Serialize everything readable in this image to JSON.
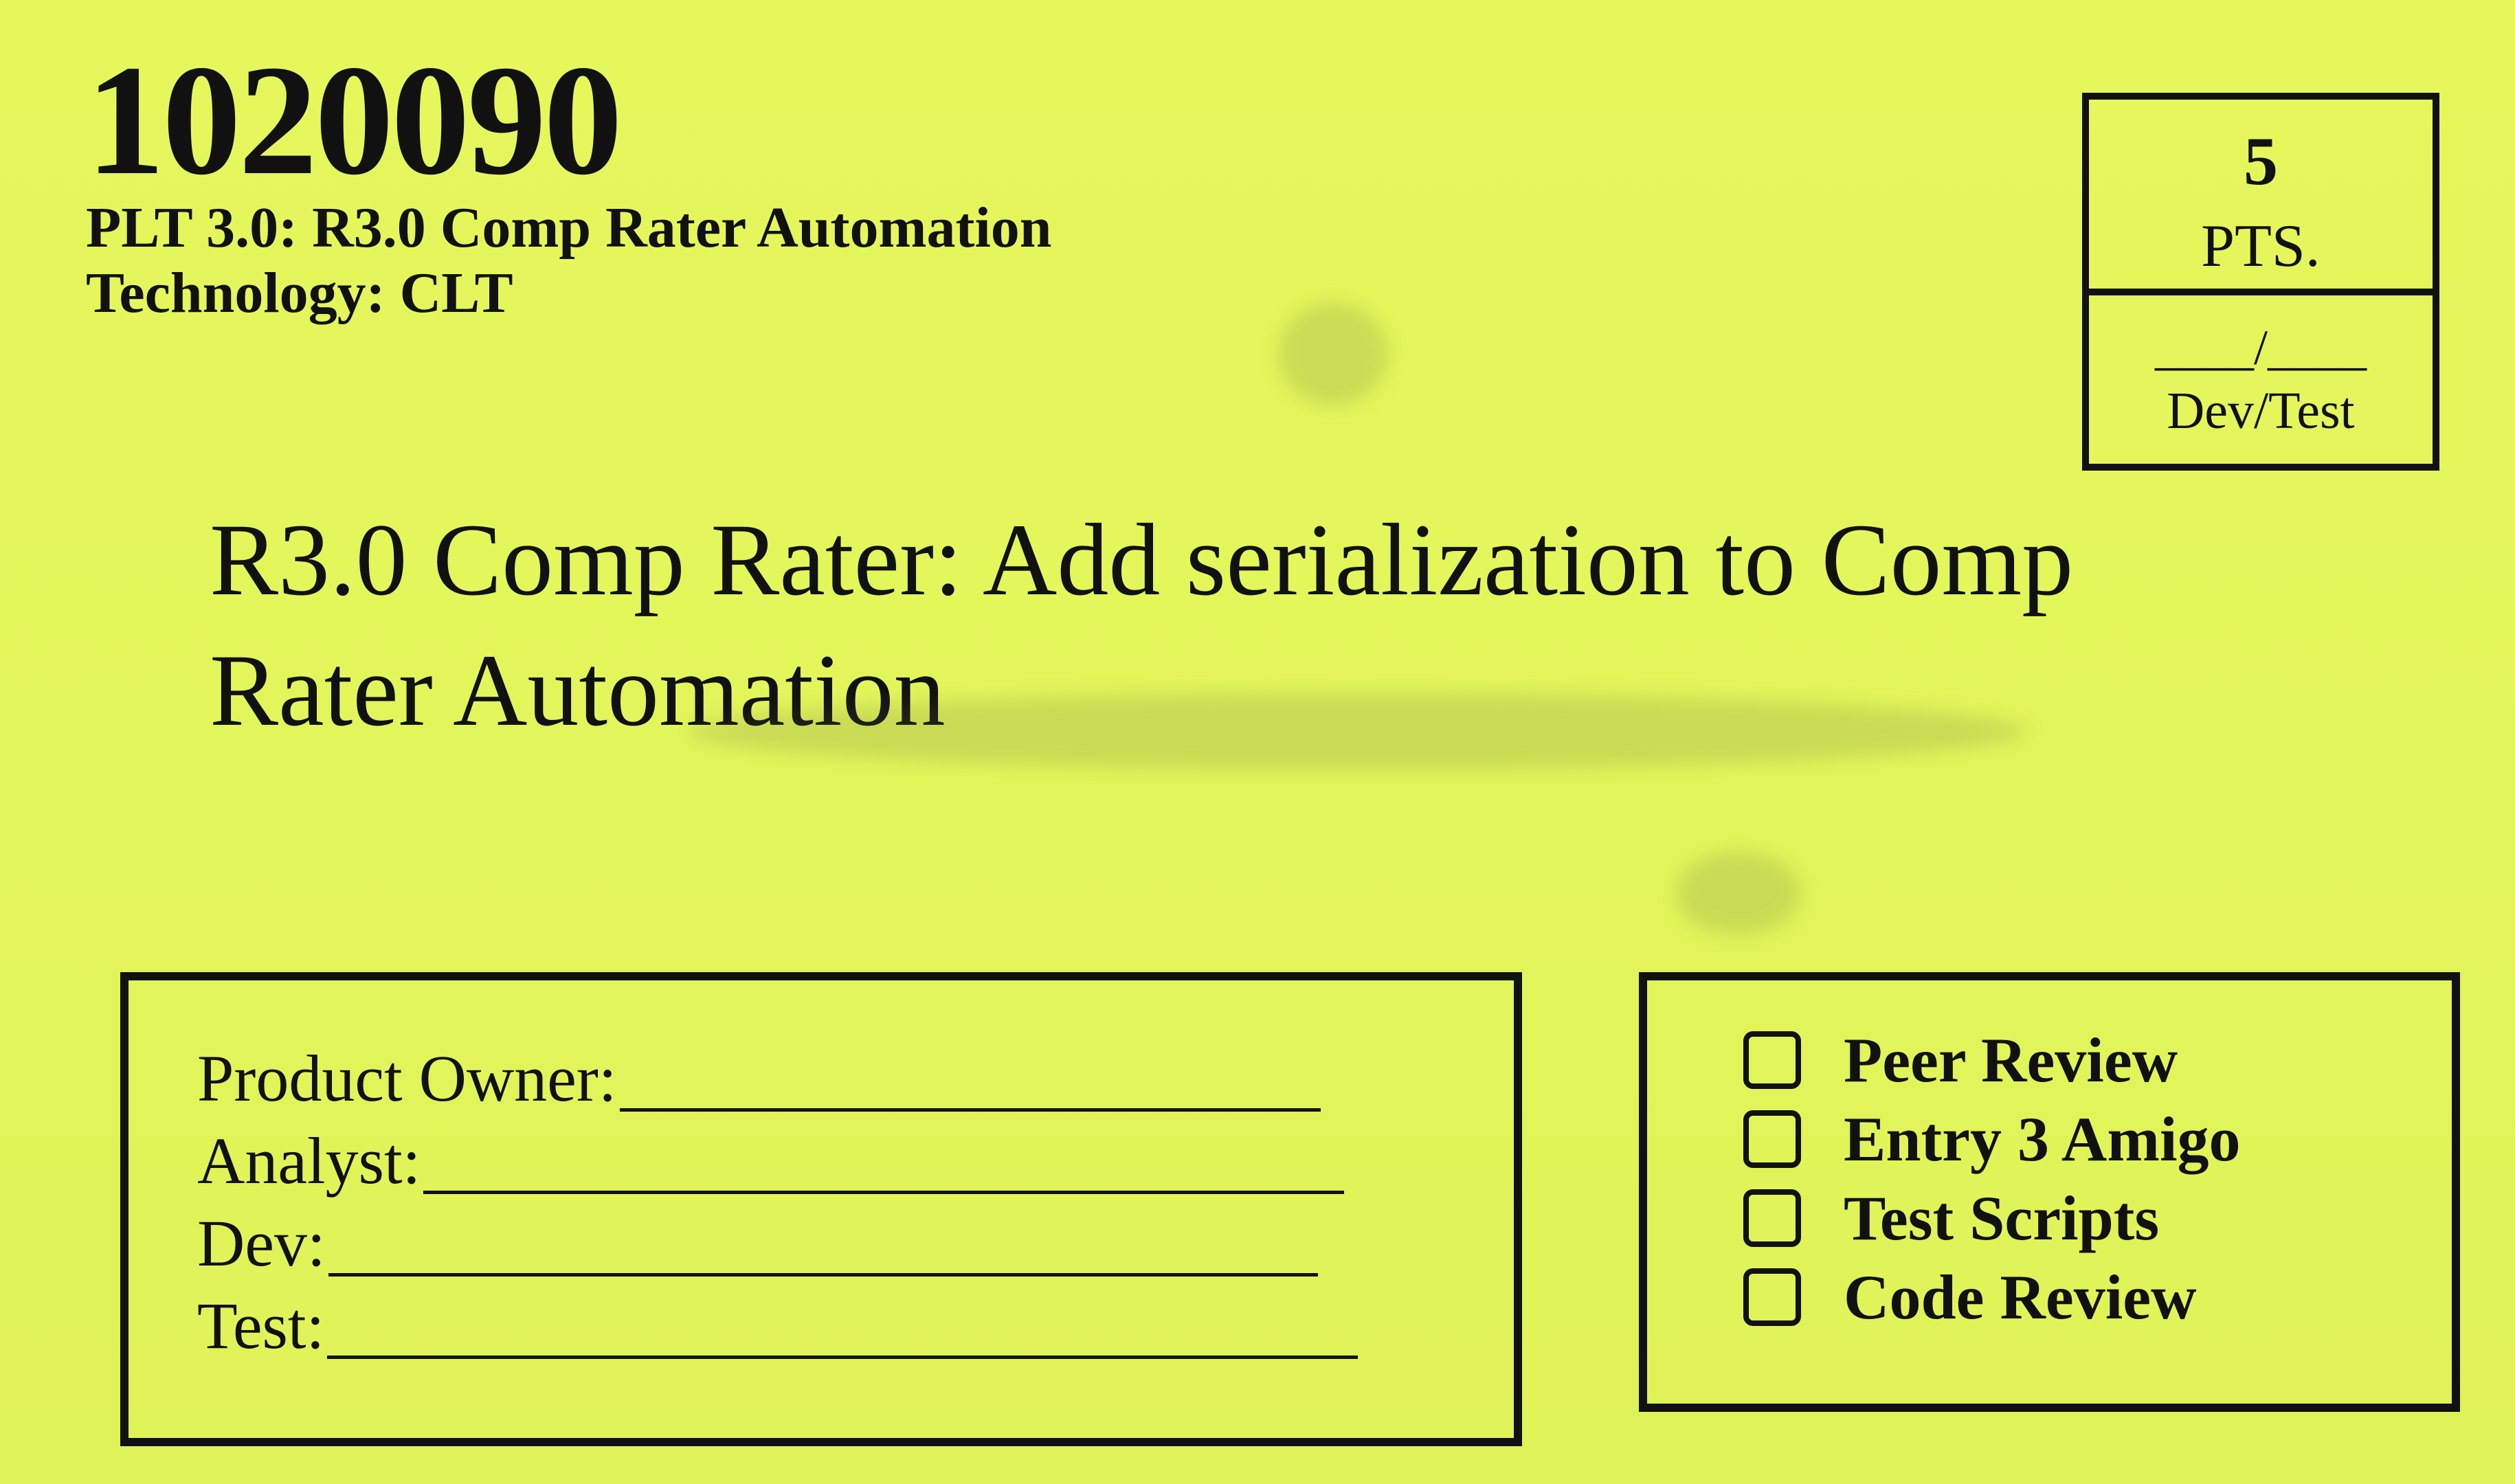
{
  "card": {
    "id": "1020090",
    "project": "PLT 3.0: R3.0 Comp Rater Automation",
    "technology": "Technology: CLT"
  },
  "points": {
    "value": "5",
    "unit": "PTS.",
    "blank": "____/____",
    "caption": "Dev/Test"
  },
  "story": {
    "line1": "R3.0 Comp Rater: Add serialization to Comp",
    "line2": "Rater Automation"
  },
  "roles": [
    {
      "label": "Product Owner:",
      "value": ""
    },
    {
      "label": "Analyst:",
      "value": ""
    },
    {
      "label": "Dev:",
      "value": ""
    },
    {
      "label": "Test:",
      "value": ""
    }
  ],
  "checklist": [
    {
      "label": "Peer Review",
      "checked": false
    },
    {
      "label": "Entry 3 Amigo",
      "checked": false
    },
    {
      "label": "Test Scripts",
      "checked": false
    },
    {
      "label": "Code Review",
      "checked": false
    }
  ],
  "colors": {
    "card_background": "#e4f55a",
    "ink": "#111111"
  }
}
